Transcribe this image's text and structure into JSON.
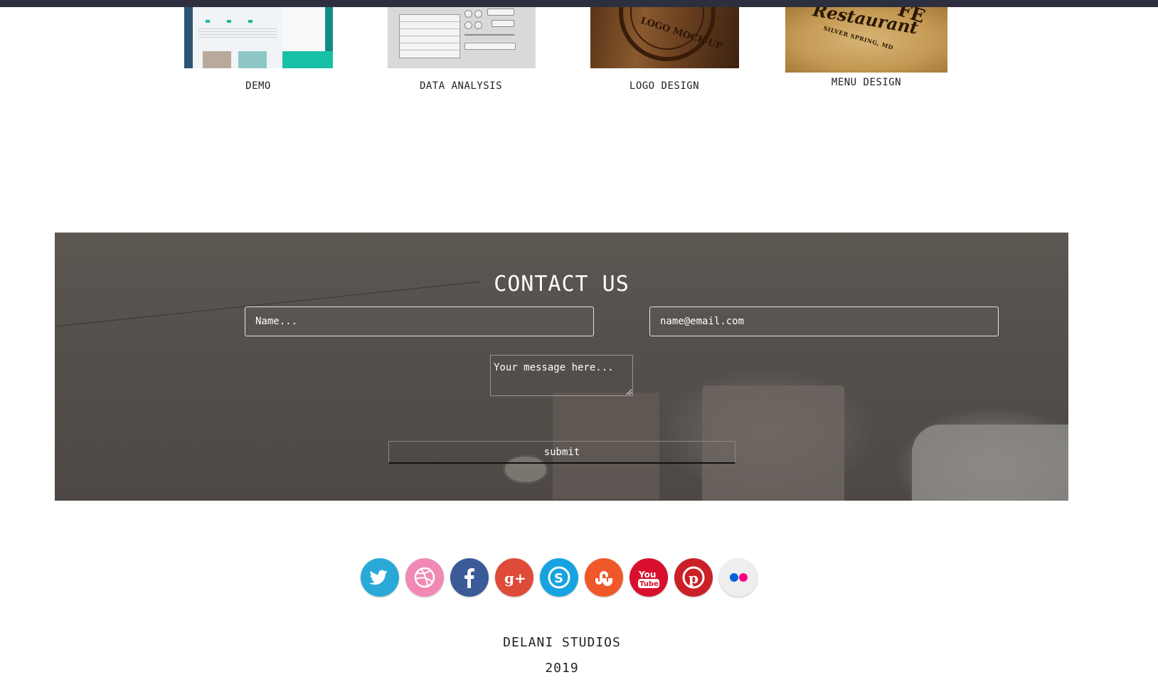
{
  "portfolio": {
    "items": [
      {
        "caption": "DEMO"
      },
      {
        "caption": "DATA ANALYSIS"
      },
      {
        "caption": "LOGO DESIGN"
      },
      {
        "caption": "MENU DESIGN"
      }
    ],
    "logo_thumb_text": "LOGO MOCK-UP",
    "menu_thumb_text": {
      "script": "Restaurant",
      "corner": "FE",
      "sub": "SILVER SPRING, MD"
    }
  },
  "contact": {
    "title": "CONTACT US",
    "name_placeholder": "Name...",
    "email_placeholder": "name@email.com",
    "message_placeholder": "Your message here...",
    "submit_label": "submit"
  },
  "social": [
    {
      "icon": "twitter-icon",
      "color": "#29a9d8"
    },
    {
      "icon": "dribbble-icon",
      "color": "#f08ab5"
    },
    {
      "icon": "facebook-icon",
      "color": "#3b5a98"
    },
    {
      "icon": "google-plus-icon",
      "color": "#de4b39"
    },
    {
      "icon": "skype-icon",
      "color": "#17a3e0"
    },
    {
      "icon": "stumbleupon-icon",
      "color": "#f0582a"
    },
    {
      "icon": "youtube-icon",
      "color": "#d8102e"
    },
    {
      "icon": "pinterest-icon",
      "color": "#cb2027"
    },
    {
      "icon": "flickr-icon",
      "color": "#eeeeee"
    }
  ],
  "footer": {
    "company": "DELANI STUDIOS",
    "year": "2019"
  }
}
